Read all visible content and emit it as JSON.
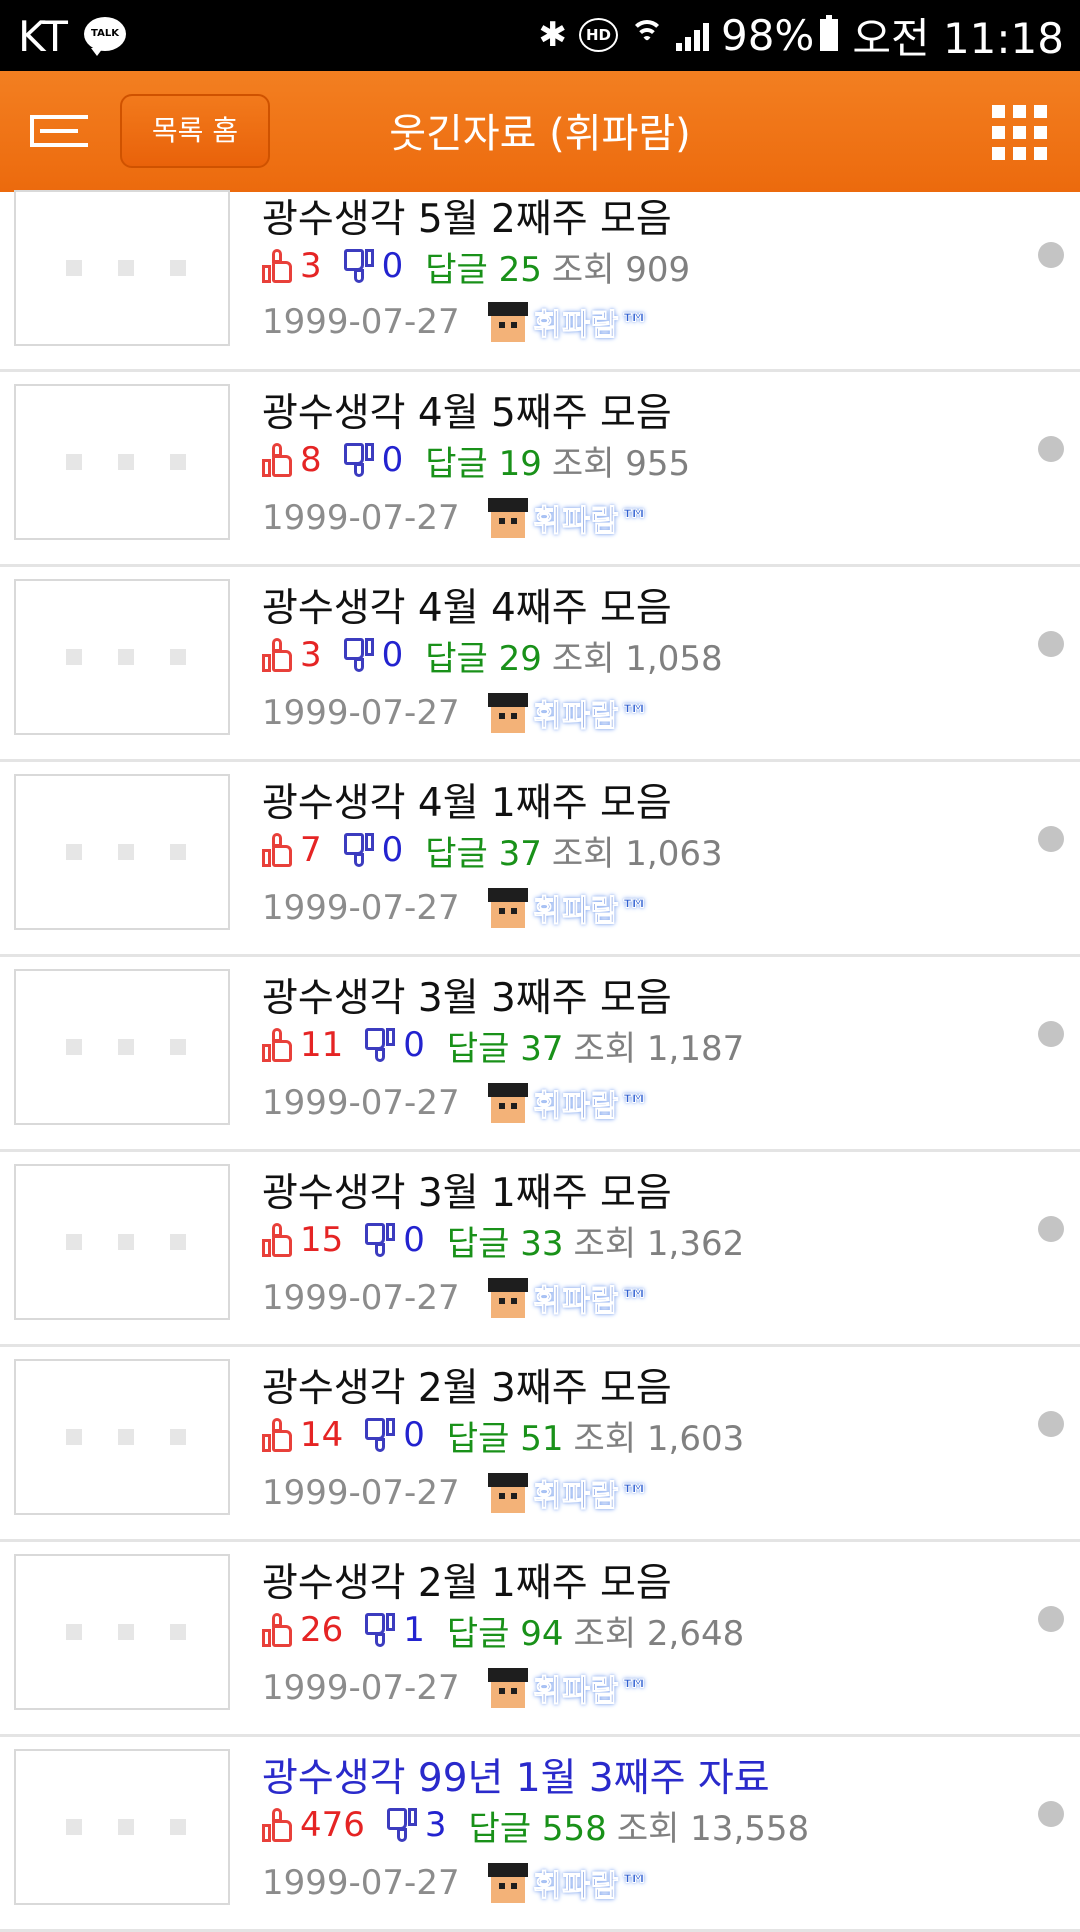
{
  "status_bar": {
    "carrier": "KT",
    "talk_badge": "TALK",
    "hd_label": "HD",
    "battery_percent": "98%",
    "time": "오전 11:18"
  },
  "app_bar": {
    "home_button": "목록 홈",
    "title": "웃긴자료 (휘파람)"
  },
  "colors": {
    "accent": "#ee7215",
    "likes": "#e52424",
    "dislikes": "#2323cf",
    "replies": "#199119",
    "views": "#808080",
    "link_title": "#2a2acb"
  },
  "posts": [
    {
      "title": "광수생각 5월 2째주 모음",
      "likes": "3",
      "dislikes": "0",
      "replies": "답글 25",
      "views": "조회 909",
      "date": "1999-07-27",
      "author": "휘파람™"
    },
    {
      "title": "광수생각 4월 5째주 모음",
      "likes": "8",
      "dislikes": "0",
      "replies": "답글 19",
      "views": "조회 955",
      "date": "1999-07-27",
      "author": "휘파람™"
    },
    {
      "title": "광수생각 4월 4째주 모음",
      "likes": "3",
      "dislikes": "0",
      "replies": "답글 29",
      "views": "조회 1,058",
      "date": "1999-07-27",
      "author": "휘파람™"
    },
    {
      "title": "광수생각 4월 1째주 모음",
      "likes": "7",
      "dislikes": "0",
      "replies": "답글 37",
      "views": "조회 1,063",
      "date": "1999-07-27",
      "author": "휘파람™"
    },
    {
      "title": "광수생각 3월 3째주 모음",
      "likes": "11",
      "dislikes": "0",
      "replies": "답글 37",
      "views": "조회 1,187",
      "date": "1999-07-27",
      "author": "휘파람™"
    },
    {
      "title": "광수생각 3월 1째주 모음",
      "likes": "15",
      "dislikes": "0",
      "replies": "답글 33",
      "views": "조회 1,362",
      "date": "1999-07-27",
      "author": "휘파람™"
    },
    {
      "title": "광수생각 2월 3째주 모음",
      "likes": "14",
      "dislikes": "0",
      "replies": "답글 51",
      "views": "조회 1,603",
      "date": "1999-07-27",
      "author": "휘파람™"
    },
    {
      "title": "광수생각 2월 1째주 모음",
      "likes": "26",
      "dislikes": "1",
      "replies": "답글 94",
      "views": "조회 2,648",
      "date": "1999-07-27",
      "author": "휘파람™"
    },
    {
      "title": "광수생각 99년 1월 3째주 자료",
      "likes": "476",
      "dislikes": "3",
      "replies": "답글 558",
      "views": "조회 13,558",
      "date": "1999-07-27",
      "author": "휘파람™"
    }
  ]
}
